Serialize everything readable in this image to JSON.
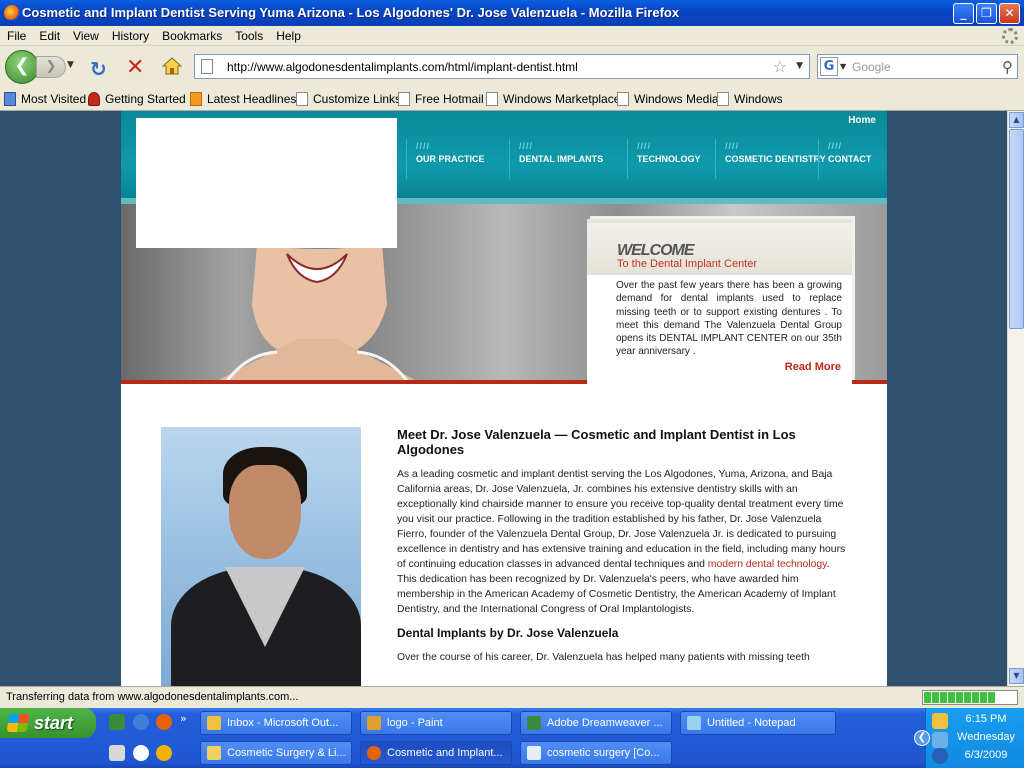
{
  "window": {
    "title": "Cosmetic and Implant Dentist Serving Yuma Arizona - Los Algodones' Dr. Jose Valenzuela - Mozilla Firefox"
  },
  "menu": [
    "File",
    "Edit",
    "View",
    "History",
    "Bookmarks",
    "Tools",
    "Help"
  ],
  "address": {
    "url": "http://www.algodonesdentalimplants.com/html/implant-dentist.html"
  },
  "search": {
    "placeholder": "Google",
    "engine_glyph": "G"
  },
  "bookmarks": [
    "Most Visited",
    "Getting Started",
    "Latest Headlines",
    "Customize Links",
    "Free Hotmail",
    "Windows Marketplace",
    "Windows Media",
    "Windows"
  ],
  "site": {
    "home_link": "Home",
    "nav": [
      "OUR PRACTICE",
      "DENTAL IMPLANTS",
      "TECHNOLOGY",
      "COSMETIC DENTISTRY",
      "CONTACT"
    ],
    "nav_dots": "////",
    "welcome": {
      "title": "WELCOME",
      "subtitle": "To the Dental Implant Center",
      "body": "Over the past few years there has been a growing demand for dental implants used to replace missing teeth or to support existing dentures . To meet this demand The Valenzuela Dental Group opens its DENTAL IMPLANT CENTER on our 35th year anniversary .",
      "read_more": "Read More"
    },
    "article": {
      "heading": "Meet Dr. Jose Valenzuela — Cosmetic and Implant Dentist in Los Algodones",
      "para1_before": "As a leading cosmetic and implant dentist serving the Los Algodones, Yuma, Arizona, and Baja California areas, Dr. Jose Valenzuela, Jr. combines his extensive dentistry skills with an exceptionally kind chairside manner to ensure you receive top-quality dental treatment every time you visit our practice.  Following in the tradition established by his father, Dr. Jose Valenzuela Fierro, founder of the Valenzuela Dental Group, Dr. Jose Valenzuela Jr. is dedicated to pursuing excellence in dentistry and has extensive training and education in the field, including many hours of continuing education classes in advanced dental techniques and ",
      "para1_link": "modern dental technology",
      "para1_after": ".  This dedication has been recognized by Dr. Valenzuela's peers, who have awarded him membership in the American Academy of Cosmetic Dentistry, the American Academy of Implant Dentistry, and the International Congress of Oral Implantologists.",
      "subheading": "Dental Implants by Dr. Jose Valenzuela",
      "para2": "Over the course of his career, Dr. Valenzuela has helped many patients with missing teeth"
    }
  },
  "status": {
    "text": "Transferring data from www.algodonesdentalimplants.com...",
    "progress_fraction": 0.85
  },
  "taskbar": {
    "start": "start",
    "overflow": "»",
    "row1": [
      "Inbox - Microsoft Out...",
      "logo - Paint",
      "Adobe Dreamweaver ...",
      "Untitled - Notepad"
    ],
    "row2": [
      "Cosmetic Surgery & Li...",
      "Cosmetic and Implant...",
      "cosmetic surgery [Co..."
    ],
    "time": "6:15 PM",
    "day": "Wednesday",
    "date": "6/3/2009"
  },
  "colors": {
    "teal": "#0e9aab",
    "accent_red": "#b72a1a",
    "page_bg": "#2f4f6f"
  }
}
